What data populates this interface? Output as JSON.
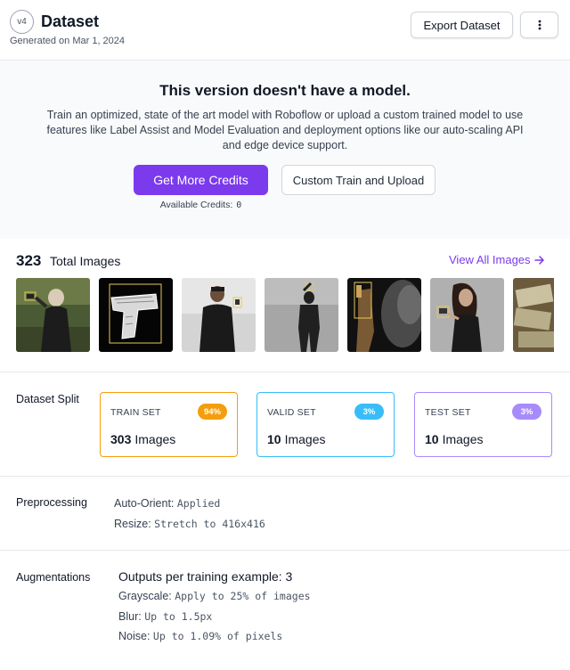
{
  "header": {
    "version": "v4",
    "title": "Dataset",
    "generated": "Generated on Mar 1, 2024",
    "export_label": "Export Dataset"
  },
  "no_model": {
    "title": "This version doesn't have a model.",
    "description": "Train an optimized, state of the art model with Roboflow or upload a custom trained model to use features like Label Assist and Model Evaluation and deployment options like our auto-scaling API and edge device support.",
    "credits_button": "Get More Credits",
    "custom_button": "Custom Train and Upload",
    "available_label": "Available Credits:",
    "available_value": "0"
  },
  "images": {
    "count": "323",
    "count_label": "Total Images",
    "view_all": "View All Images",
    "thumbnails": [
      "woman-with-gun-thumbnail",
      "xray-pistol-thumbnail",
      "man-with-gun-thumbnail",
      "silhouette-thumbnail",
      "dark-figure-thumbnail",
      "woman-aiming-thumbnail",
      "money-thumbnail"
    ]
  },
  "split": {
    "label": "Dataset Split",
    "cards": [
      {
        "title": "TRAIN SET",
        "badge": "94%",
        "count": "303",
        "unit": "Images",
        "color": "#f59e0b"
      },
      {
        "title": "VALID SET",
        "badge": "3%",
        "count": "10",
        "unit": "Images",
        "color": "#38bdf8"
      },
      {
        "title": "TEST SET",
        "badge": "3%",
        "count": "10",
        "unit": "Images",
        "color": "#a78bfa"
      }
    ]
  },
  "preprocessing": {
    "label": "Preprocessing",
    "items": [
      {
        "key": "Auto-Orient:",
        "value": "Applied"
      },
      {
        "key": "Resize:",
        "value": "Stretch to 416x416"
      }
    ]
  },
  "augmentations": {
    "label": "Augmentations",
    "outputs": "Outputs per training example: 3",
    "items": [
      {
        "key": "Grayscale:",
        "value": "Apply to 25% of images"
      },
      {
        "key": "Blur:",
        "value": "Up to 1.5px"
      },
      {
        "key": "Noise:",
        "value": "Up to 1.09% of pixels"
      }
    ]
  }
}
